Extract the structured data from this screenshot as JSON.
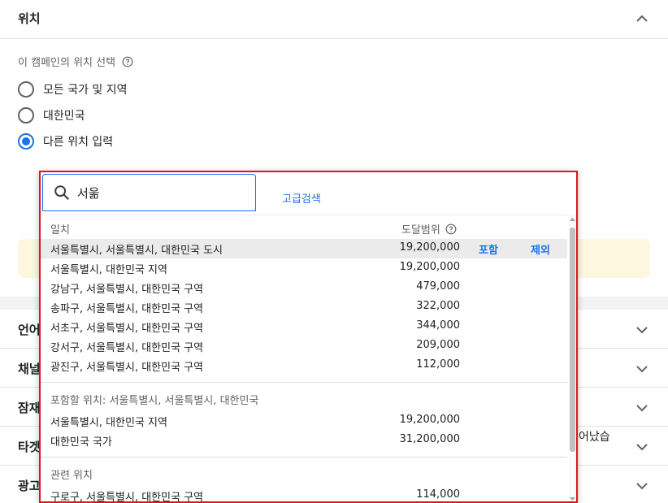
{
  "location": {
    "title": "위치",
    "select_label": "이 캠페인의 위치 선택",
    "options": [
      {
        "label": "모든 국가 및 지역",
        "checked": false
      },
      {
        "label": "대한민국",
        "checked": false
      },
      {
        "label": "다른 위치 입력",
        "checked": true
      }
    ]
  },
  "search": {
    "value": "서욺",
    "advanced_label": "고급검색"
  },
  "results": {
    "match_header": "일치",
    "reach_header": "도달범위",
    "include_label": "포함",
    "exclude_label": "제외",
    "matches": [
      {
        "name": "서울특별시, 서울특별시, 대한민국 도시",
        "reach": "19,200,000"
      },
      {
        "name": "서울특별시, 대한민국 지역",
        "reach": "19,200,000"
      },
      {
        "name": "강남구, 서울특별시, 대한민국 구역",
        "reach": "479,000"
      },
      {
        "name": "송파구, 서울특별시, 대한민국 구역",
        "reach": "322,000"
      },
      {
        "name": "서초구, 서울특별시, 대한민국 구역",
        "reach": "344,000"
      },
      {
        "name": "강서구, 서울특별시, 대한민국 구역",
        "reach": "209,000"
      },
      {
        "name": "광진구, 서울특별시, 대한민국 구역",
        "reach": "112,000"
      }
    ],
    "containing_title": "포함할 위치: 서울특별시, 서울특별시, 대한민국",
    "containing": [
      {
        "name": "서울특별시, 대한민국 지역",
        "reach": "19,200,000"
      },
      {
        "name": "대한민국 국가",
        "reach": "31,200,000"
      }
    ],
    "related_title": "관련 위치",
    "related": [
      {
        "name": "구로구, 서울특별시, 대한민국 구역",
        "reach": "114,000"
      }
    ]
  },
  "sections": [
    {
      "title": "언어"
    },
    {
      "title": "채널"
    },
    {
      "title": "잠재"
    },
    {
      "title": "타겟"
    },
    {
      "title": "광고"
    }
  ],
  "side_text": "어났습",
  "colors": {
    "accent": "#1a73e8",
    "highlight_border": "#e2121f",
    "notice_bg": "#fef7e0"
  }
}
